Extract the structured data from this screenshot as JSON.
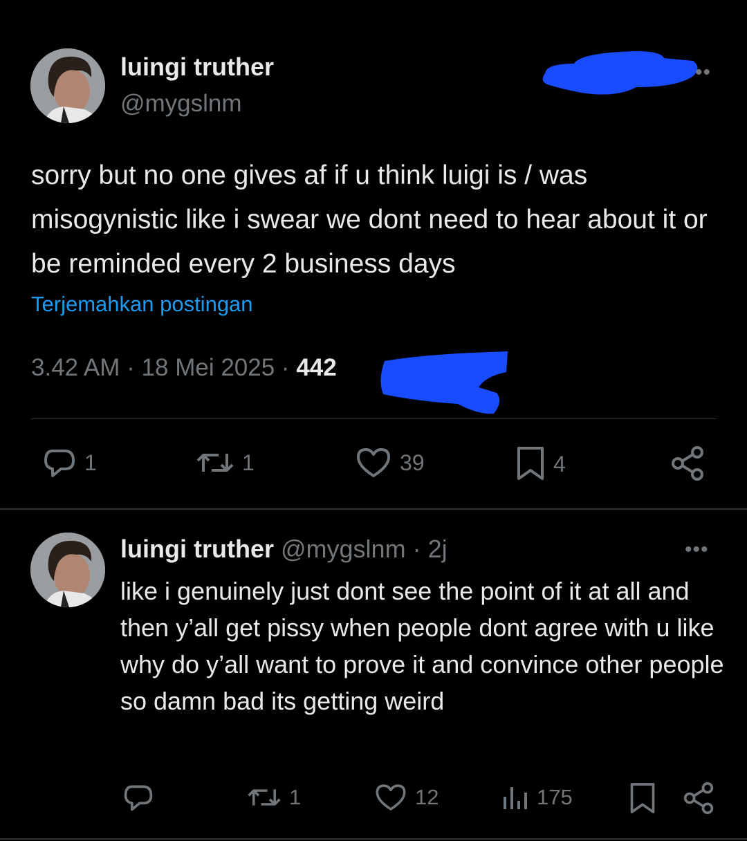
{
  "main_post": {
    "display_name": "luingi truther",
    "handle": "@mygslnm",
    "text": "sorry but no one gives af if u think luigi is / was misogynistic like i swear we dont need to hear about it or be reminded every 2 business days",
    "translate_label": "Terjemahkan postingan",
    "time": "3.42 AM",
    "date": "18 Mei 2025",
    "views_partial": "442",
    "replies": "1",
    "reposts": "1",
    "likes": "39",
    "bookmarks": "4"
  },
  "reply_post": {
    "display_name": "luingi truther",
    "handle": "@mygslnm",
    "age": "2j",
    "text": "like i genuinely just dont see the point of it at all and then y’all get pissy when people dont agree with u like why do y’all want to prove it and convince other people so damn bad its getting weird",
    "reposts": "1",
    "likes": "12",
    "views": "175"
  },
  "colors": {
    "background": "#000000",
    "text_primary": "#e7e9ea",
    "text_secondary": "#71767b",
    "link": "#1d9bf0",
    "divider": "#2f3336",
    "redaction": "#1a4cff"
  },
  "icons": [
    "more-icon",
    "reply-icon",
    "repost-icon",
    "like-icon",
    "bookmark-icon",
    "share-icon",
    "views-icon"
  ]
}
